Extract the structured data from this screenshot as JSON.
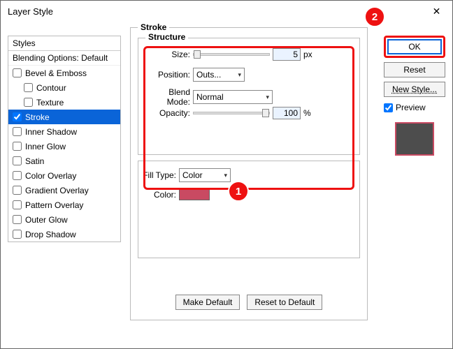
{
  "window": {
    "title": "Layer Style"
  },
  "styles": {
    "header": "Styles",
    "blending": "Blending Options: Default",
    "items": [
      {
        "label": "Bevel & Emboss",
        "checked": false,
        "sub": false,
        "selected": false
      },
      {
        "label": "Contour",
        "checked": false,
        "sub": true,
        "selected": false
      },
      {
        "label": "Texture",
        "checked": false,
        "sub": true,
        "selected": false
      },
      {
        "label": "Stroke",
        "checked": true,
        "sub": false,
        "selected": true
      },
      {
        "label": "Inner Shadow",
        "checked": false,
        "sub": false,
        "selected": false
      },
      {
        "label": "Inner Glow",
        "checked": false,
        "sub": false,
        "selected": false
      },
      {
        "label": "Satin",
        "checked": false,
        "sub": false,
        "selected": false
      },
      {
        "label": "Color Overlay",
        "checked": false,
        "sub": false,
        "selected": false
      },
      {
        "label": "Gradient Overlay",
        "checked": false,
        "sub": false,
        "selected": false
      },
      {
        "label": "Pattern Overlay",
        "checked": false,
        "sub": false,
        "selected": false
      },
      {
        "label": "Outer Glow",
        "checked": false,
        "sub": false,
        "selected": false
      },
      {
        "label": "Drop Shadow",
        "checked": false,
        "sub": false,
        "selected": false
      }
    ]
  },
  "stroke": {
    "group_title": "Stroke",
    "structure_title": "Structure",
    "size_label": "Size:",
    "size_value": "5",
    "size_unit": "px",
    "position_label": "Position:",
    "position_value": "Outs...",
    "blend_label": "Blend Mode:",
    "blend_value": "Normal",
    "opacity_label": "Opacity:",
    "opacity_value": "100",
    "opacity_unit": "%",
    "filltype_label": "Fill Type:",
    "filltype_value": "Color",
    "color_label": "Color:",
    "color_hex": "#c94a62",
    "make_default": "Make Default",
    "reset_default": "Reset to Default"
  },
  "right": {
    "ok": "OK",
    "reset": "Reset",
    "new_style": "New Style...",
    "preview": "Preview"
  },
  "callouts": {
    "one": "1",
    "two": "2"
  }
}
